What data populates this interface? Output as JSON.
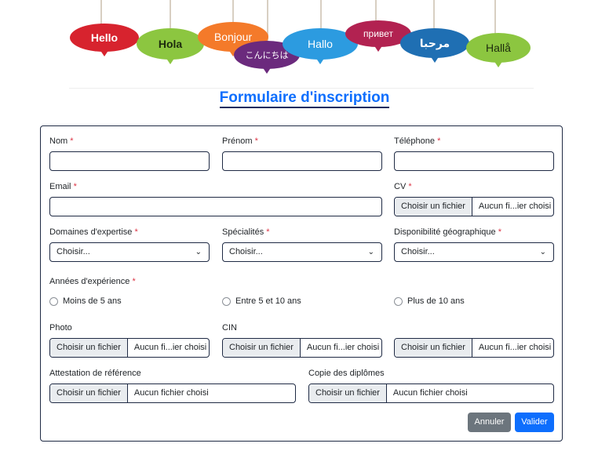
{
  "banner": {
    "words": [
      "Hello",
      "Hola",
      "Bonjour",
      "こんにちは",
      "Hallo",
      "привет",
      "مرحبا",
      "Hallå"
    ]
  },
  "title": "Formulaire d'inscription",
  "form": {
    "required_mark": "*",
    "nom": {
      "label": "Nom",
      "value": ""
    },
    "prenom": {
      "label": "Prénom",
      "value": ""
    },
    "telephone": {
      "label": "Téléphone",
      "value": ""
    },
    "email": {
      "label": "Email",
      "value": ""
    },
    "cv": {
      "label": "CV",
      "button": "Choisir un fichier",
      "status": "Aucun fi...ier choisi"
    },
    "domaines": {
      "label": "Domaines d'expertise",
      "selected": "Choisir..."
    },
    "specialites": {
      "label": "Spécialités",
      "selected": "Choisir..."
    },
    "disponibilite": {
      "label": "Disponibilité géographique",
      "selected": "Choisir..."
    },
    "annees": {
      "label": "Années d'expérience",
      "options": [
        "Moins de 5 ans",
        "Entre 5 et 10 ans",
        "Plus de 10 ans"
      ]
    },
    "photo": {
      "label": "Photo",
      "button": "Choisir un fichier",
      "status": "Aucun fi...ier choisi"
    },
    "cin": {
      "label": "CIN",
      "button": "Choisir un fichier",
      "status": "Aucun fi...ier choisi"
    },
    "extra_file": {
      "button": "Choisir un fichier",
      "status": "Aucun fi...ier choisi"
    },
    "attestation": {
      "label": "Attestation de référence",
      "button": "Choisir un fichier",
      "status": "Aucun fichier choisi"
    },
    "diplomes": {
      "label": "Copie des diplômes",
      "button": "Choisir un fichier",
      "status": "Aucun fichier choisi"
    },
    "cancel_label": "Annuler",
    "submit_label": "Valider"
  },
  "colors": {
    "primary": "#0d6efd",
    "secondary": "#6c757d",
    "required": "#dc3545",
    "border": "#1f2a44"
  }
}
